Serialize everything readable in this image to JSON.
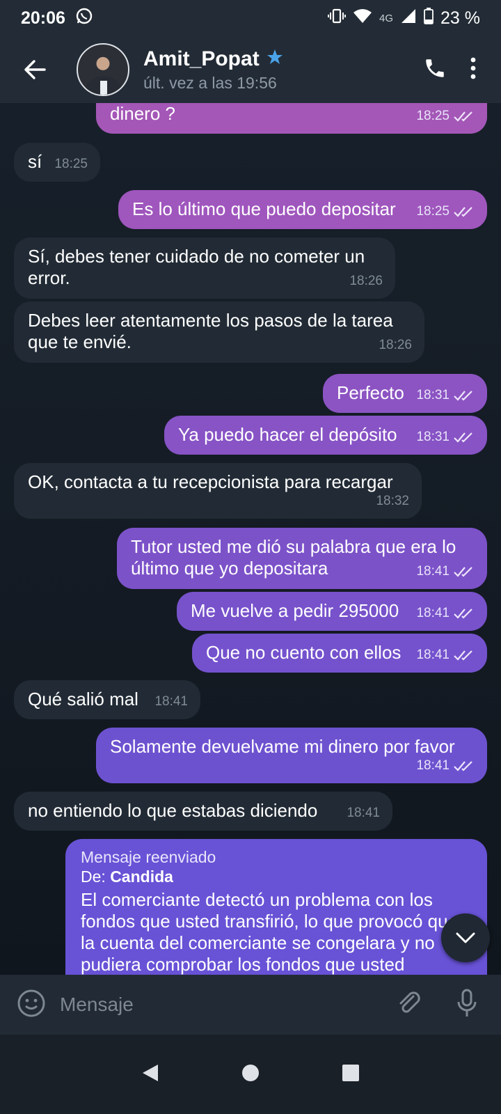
{
  "status_bar": {
    "time": "20:06",
    "network": "4G",
    "battery": "23 %"
  },
  "header": {
    "contact_name": "Amit_Popat",
    "last_seen": "últ. vez a las 19:56"
  },
  "messages": [
    {
      "dir": "out",
      "text": "dinero ?",
      "time": "18:25"
    },
    {
      "dir": "in",
      "text": "sí",
      "time": "18:25"
    },
    {
      "dir": "out",
      "text": "Es lo último que puedo depositar",
      "time": "18:25"
    },
    {
      "dir": "in",
      "text": "Sí, debes tener cuidado de no cometer un error.",
      "time": "18:26"
    },
    {
      "dir": "in",
      "text": "Debes leer atentamente los pasos de la tarea que te envié.",
      "time": "18:26"
    },
    {
      "dir": "out",
      "text": "Perfecto",
      "time": "18:31"
    },
    {
      "dir": "out",
      "text": "Ya puedo hacer el depósito",
      "time": "18:31"
    },
    {
      "dir": "in",
      "text": "OK, contacta a tu recepcionista para recargar",
      "time": "18:32"
    },
    {
      "dir": "out",
      "text": "Tutor usted me dió su palabra que era lo último que yo depositara",
      "time": "18:41"
    },
    {
      "dir": "out",
      "text": "Me vuelve a pedir 295000",
      "time": "18:41"
    },
    {
      "dir": "out",
      "text": "Que no cuento con ellos",
      "time": "18:41"
    },
    {
      "dir": "in",
      "text": "Qué salió mal",
      "time": "18:41"
    },
    {
      "dir": "out",
      "text": "Solamente devuelvame mi dinero por favor",
      "time": "18:41"
    },
    {
      "dir": "in",
      "text": "no entiendo lo que estabas diciendo",
      "time": "18:41"
    }
  ],
  "forwarded": {
    "title": "Mensaje reenviado",
    "from_label": "De:",
    "from_name": "Candida",
    "text": "El comerciante detectó un problema con los fondos que usted transfirió, lo que provocó que la cuenta del comerciante se congelara y no pudiera comprobar los fondos que usted"
  },
  "input": {
    "placeholder": "Mensaje"
  },
  "colors": {
    "bar_bg": "#232c36",
    "incoming_bubble": "#222b35",
    "outgoing_top": "#a352b8",
    "outgoing_bottom": "#6552d8",
    "verified_star": "#4aa3e8"
  }
}
